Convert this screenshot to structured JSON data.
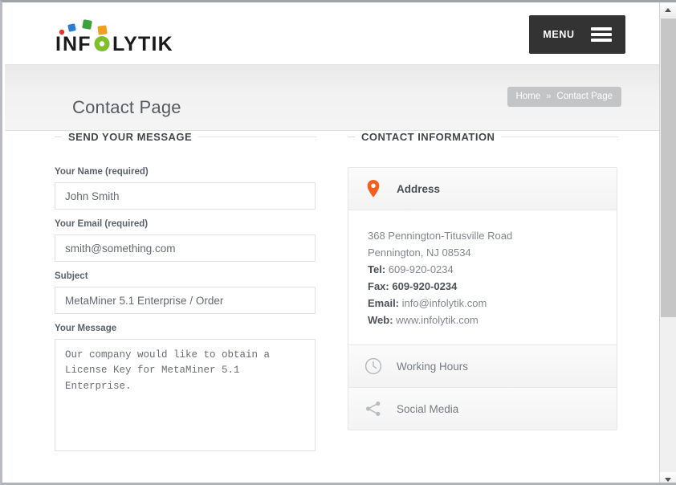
{
  "header": {
    "logo_text": "INFOLYTIK",
    "logo_colors": [
      "#e8342a",
      "#2a7fd4",
      "#3aa33a",
      "#f0a01e",
      "#7fbf2a"
    ],
    "menu_label": "MENU",
    "menu_icon": "hamburger-icon"
  },
  "banner": {
    "title": "Contact Page",
    "breadcrumb": {
      "home": "Home",
      "separator": "»",
      "current": "Contact Page"
    }
  },
  "form": {
    "section_title": "SEND YOUR MESSAGE",
    "fields": [
      {
        "label": "Your Name (required)",
        "value": "John Smith",
        "placeholder": ""
      },
      {
        "label": "Your Email (required)",
        "value": "smith@something.com",
        "placeholder": ""
      },
      {
        "label": "Subject",
        "value": "MetaMiner 5.1 Enterprise / Order",
        "placeholder": ""
      }
    ],
    "message": {
      "label": "Your Message",
      "value": "Our company would like to obtain a\nLicense Key for MetaMiner 5.1\nEnterprise.",
      "placeholder": ""
    }
  },
  "contact": {
    "section_title": "CONTACT INFORMATION",
    "accent_color": "#f4601f",
    "panels": [
      {
        "title": "Address",
        "icon": "map-pin-icon",
        "expanded": true,
        "lines": [
          {
            "label": "",
            "value": "368 Pennington-Titusville Road",
            "style": "normal"
          },
          {
            "label": "",
            "value": "Pennington, NJ 08534",
            "style": "normal"
          },
          {
            "label": "Tel:",
            "value": "609-920-0234",
            "style": "label-bold"
          },
          {
            "label": "Fax:",
            "value": "609-920-0234",
            "style": "all-bold"
          },
          {
            "label": "Email:",
            "value": "info@infolytik.com",
            "style": "label-bold"
          },
          {
            "label": "Web:",
            "value": "www.infolytik.com",
            "style": "label-bold"
          }
        ]
      },
      {
        "title": "Working Hours",
        "icon": "clock-icon",
        "expanded": false,
        "lines": []
      },
      {
        "title": "Social Media",
        "icon": "share-icon",
        "expanded": false,
        "lines": []
      }
    ]
  },
  "scrollbar": {
    "up_arrow": "chevron-up-icon",
    "down_arrow": "chevron-down-icon"
  }
}
